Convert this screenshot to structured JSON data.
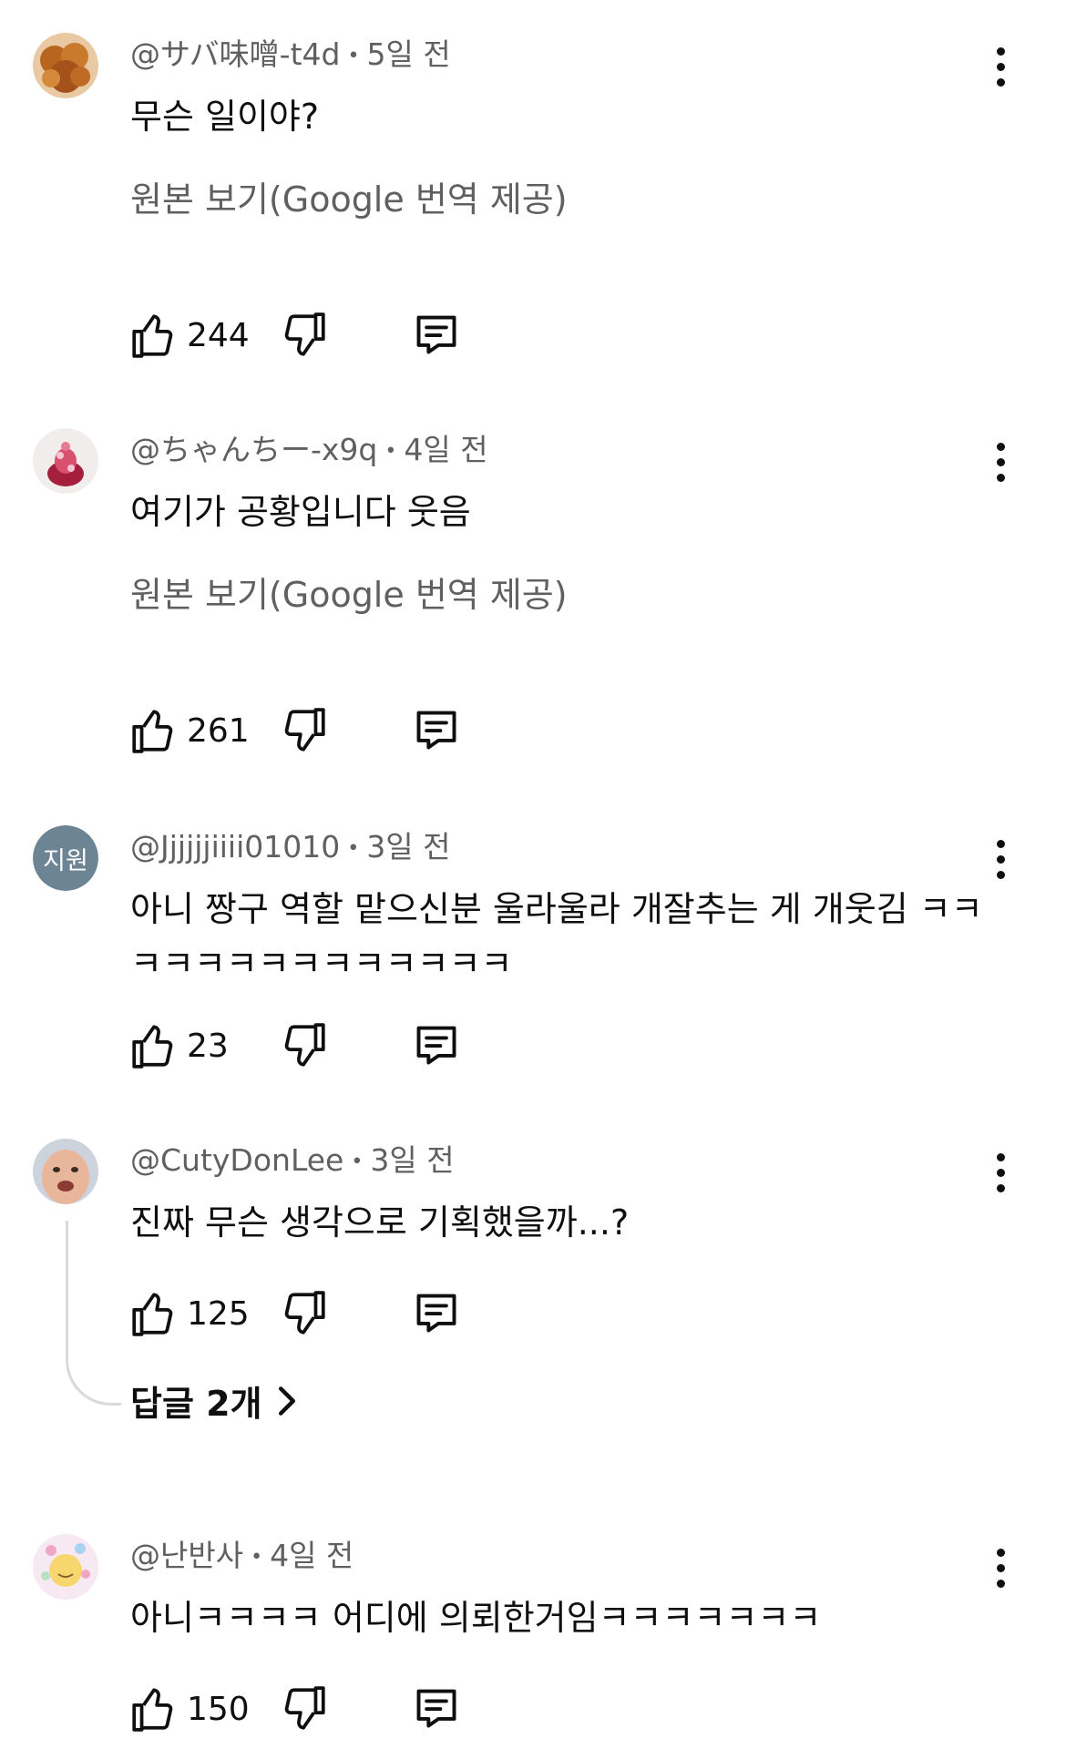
{
  "comments": [
    {
      "author": "@サバ味噌-t4d",
      "time": "5일 전",
      "text": "무슨 일이야?",
      "translate": "원본 보기(Google 번역 제공)",
      "likes": "244"
    },
    {
      "author": "@ちゃんちー-x9q",
      "time": "4일 전",
      "text": "여기가 공황입니다 웃음",
      "translate": "원본 보기(Google 번역 제공)",
      "likes": "261"
    },
    {
      "author": "@Jjjjjjiiii01010",
      "avatar_letters": "지원",
      "time": "3일 전",
      "text": "아니 짱구 역할 맡으신분 울라울라 개잘추는 게 개웃김 ㅋㅋㅋㅋㅋㅋㅋㅋㅋㅋㅋㅋㅋㅋ",
      "likes": "23"
    },
    {
      "author": "@CutyDonLee",
      "time": "3일 전",
      "text": "진짜 무슨 생각으로 기획했을까...?",
      "likes": "125",
      "replies": "답글 2개"
    },
    {
      "author": "@난반사",
      "time": "4일 전",
      "text": "아니ㅋㅋㅋㅋ 어디에 의뢰한거임ㅋㅋㅋㅋㅋㅋㅋ",
      "likes": "150"
    }
  ],
  "separator": "•",
  "icons": {
    "like": "thumbs-up-icon",
    "dislike": "thumbs-down-icon",
    "reply": "comment-reply-icon",
    "more": "more-vert-icon",
    "chevron": "chevron-right-icon"
  },
  "colors": {
    "text": "#0f0f0f",
    "secondary": "#606060",
    "letter_avatar_bg": "#6d8494"
  }
}
